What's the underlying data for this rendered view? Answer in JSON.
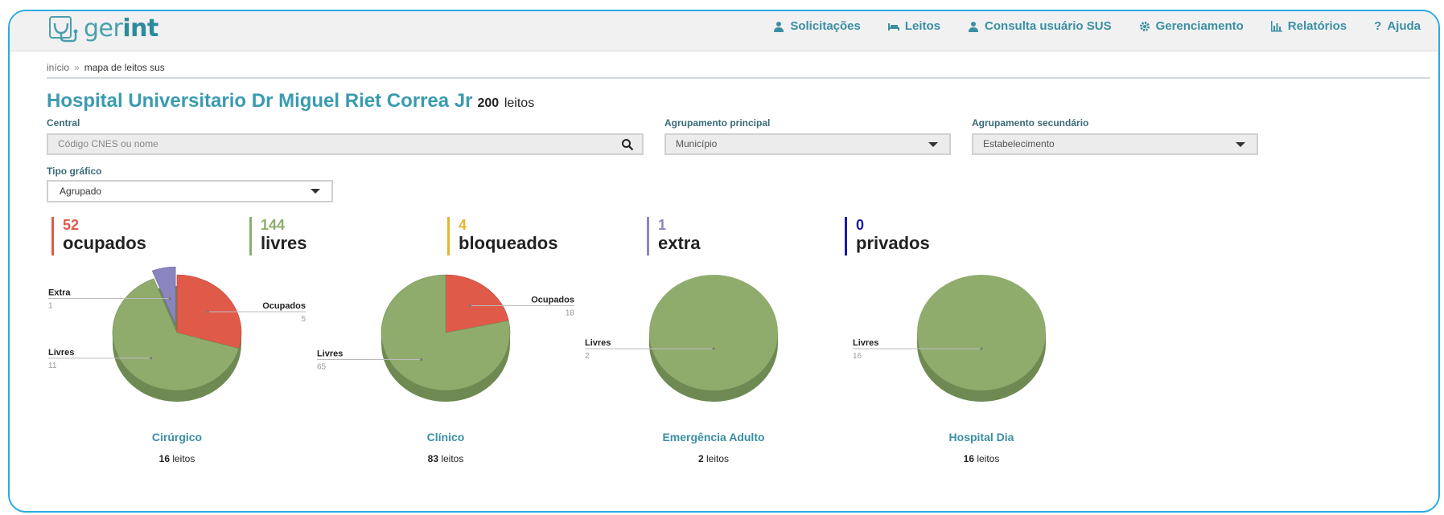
{
  "app": {
    "logo_prefix": "ger",
    "logo_suffix": "int"
  },
  "nav": [
    {
      "label": "Solicitações",
      "icon": "user-icon"
    },
    {
      "label": "Leitos",
      "icon": "bed-icon"
    },
    {
      "label": "Consulta usuário SUS",
      "icon": "user-icon"
    },
    {
      "label": "Gerenciamento",
      "icon": "gear-icon"
    },
    {
      "label": "Relatórios",
      "icon": "bar-chart-icon"
    },
    {
      "label": "Ajuda",
      "icon": "question-icon"
    }
  ],
  "breadcrumb": {
    "home": "início",
    "separator": "»",
    "current": "mapa de leitos sus"
  },
  "hospital": {
    "name": "Hospital Universitario Dr Miguel Riet Correa Jr",
    "count": "200",
    "unit": "leitos"
  },
  "filters": {
    "central_label": "Central",
    "central_placeholder": "Código CNES ou nome",
    "principal_label": "Agrupamento principal",
    "principal_value": "Município",
    "secundario_label": "Agrupamento secundário",
    "secundario_value": "Estabelecimento",
    "tipo_label": "Tipo gráfico",
    "tipo_value": "Agrupado"
  },
  "stats": [
    {
      "value": "52",
      "label": "ocupados",
      "color": "#e05a4a"
    },
    {
      "value": "144",
      "label": "livres",
      "color": "#8fad6b"
    },
    {
      "value": "4",
      "label": "bloqueados",
      "color": "#e6b52e"
    },
    {
      "value": "1",
      "label": "extra",
      "color": "#8c86c0"
    },
    {
      "value": "0",
      "label": "privados",
      "color": "#1a1aa8"
    }
  ],
  "colors": {
    "livres": "#8fac6d",
    "livres_dark": "#6e8a52",
    "ocupados": "#e05a4a",
    "ocupados_dark": "#b8463a",
    "extra": "#8a84bf",
    "extra_dark": "#6b66a0",
    "accent": "#3a9bb0"
  },
  "chart_data": [
    {
      "type": "pie",
      "title": "Cirúrgico",
      "total": "16",
      "unit": "leitos",
      "slices": [
        {
          "name": "Ocupados",
          "value": 5
        },
        {
          "name": "Livres",
          "value": 11
        },
        {
          "name": "Extra",
          "value": 1
        }
      ]
    },
    {
      "type": "pie",
      "title": "Clínico",
      "total": "83",
      "unit": "leitos",
      "slices": [
        {
          "name": "Ocupados",
          "value": 18
        },
        {
          "name": "Livres",
          "value": 65
        }
      ]
    },
    {
      "type": "pie",
      "title": "Emergência Adulto",
      "total": "2",
      "unit": "leitos",
      "slices": [
        {
          "name": "Livres",
          "value": 2
        }
      ]
    },
    {
      "type": "pie",
      "title": "Hospital Dia",
      "total": "16",
      "unit": "leitos",
      "slices": [
        {
          "name": "Livres",
          "value": 16
        }
      ]
    }
  ]
}
